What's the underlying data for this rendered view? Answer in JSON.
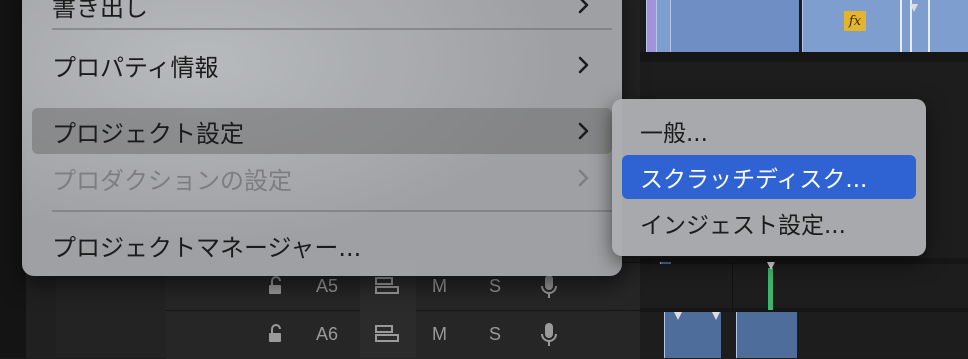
{
  "context_menu": {
    "items": [
      {
        "label": "書き出し",
        "has_submenu": true,
        "state": "normal"
      },
      {
        "label": "プロパティ情報",
        "has_submenu": true,
        "state": "normal"
      },
      {
        "label": "プロジェクト設定",
        "has_submenu": true,
        "state": "active"
      },
      {
        "label": "プロダクションの設定",
        "has_submenu": true,
        "state": "disabled"
      },
      {
        "label": "プロジェクトマネージャー...",
        "has_submenu": false,
        "state": "normal"
      }
    ]
  },
  "submenu": {
    "items": [
      {
        "label": "一般...",
        "state": "normal"
      },
      {
        "label": "スクラッチディスク...",
        "state": "highlighted"
      },
      {
        "label": "インジェスト設定...",
        "state": "normal"
      }
    ]
  },
  "tracks": [
    {
      "name": "A5",
      "lock_icon": "lock-open-icon",
      "sync_icon": "track-output-icon",
      "mute": "M",
      "solo": "S",
      "voice_icon": "microphone-icon"
    },
    {
      "name": "A6",
      "lock_icon": "lock-open-icon",
      "sync_icon": "track-output-icon",
      "mute": "M",
      "solo": "S",
      "voice_icon": "microphone-icon"
    }
  ],
  "timeline": {
    "fx_badge": "fx"
  },
  "colors": {
    "menu_bg": "#a8aaad",
    "submenu_highlight": "#2f63d3",
    "clip_blue": "#7e9ed0",
    "clip_purple": "#a593d9",
    "fx_yellow": "#e4b42c"
  }
}
